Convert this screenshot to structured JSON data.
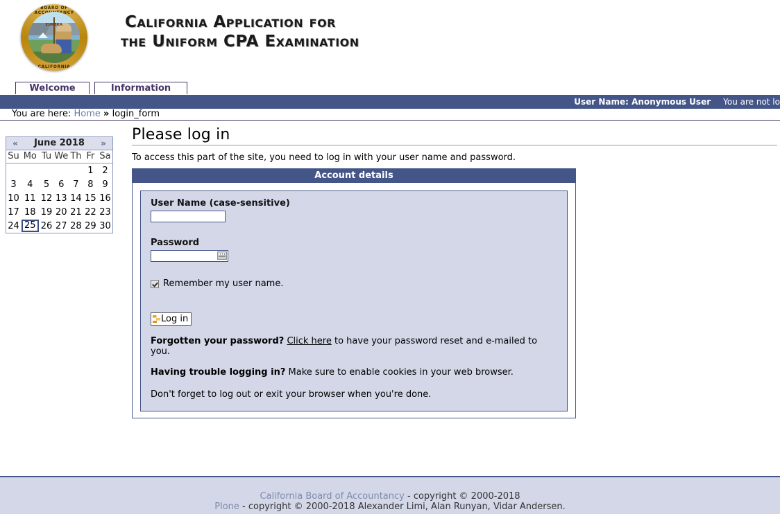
{
  "header": {
    "logo_alt": "California Board of Accountancy Seal",
    "seal": {
      "ring_top": "BOARD OF ACCOUNTANCY",
      "ring_bottom": "CALIFORNIA",
      "motto": "EUREKA"
    },
    "title_line1": "California Application for",
    "title_line2": "the Uniform CPA Examination"
  },
  "globalnav": {
    "tabs": [
      {
        "label": "Welcome",
        "selected": false
      },
      {
        "label": "Information",
        "selected": false
      }
    ]
  },
  "personaltools": {
    "user_name_label": "User Name: Anonymous User",
    "login_status": "You are not lo"
  },
  "breadcrumbs": {
    "prefix": "You are here:",
    "home": "Home",
    "separator": "»",
    "current": "login_form"
  },
  "calendar": {
    "prev_label": "«",
    "next_label": "»",
    "month_year": "June 2018",
    "weekdays": [
      "Su",
      "Mo",
      "Tu",
      "We",
      "Th",
      "Fr",
      "Sa"
    ],
    "weeks": [
      [
        "",
        "",
        "",
        "",
        "",
        "1",
        "2"
      ],
      [
        "3",
        "4",
        "5",
        "6",
        "7",
        "8",
        "9"
      ],
      [
        "10",
        "11",
        "12",
        "13",
        "14",
        "15",
        "16"
      ],
      [
        "17",
        "18",
        "19",
        "20",
        "21",
        "22",
        "23"
      ],
      [
        "24",
        "25",
        "26",
        "27",
        "28",
        "29",
        "30"
      ]
    ],
    "today": "25"
  },
  "content": {
    "title": "Please log in",
    "description": "To access this part of the site, you need to log in with your user name and password."
  },
  "login_form": {
    "panel_title": "Account details",
    "username_label": "User Name (case-sensitive)",
    "username_value": "",
    "username_placeholder": "",
    "password_label": "Password",
    "password_value": "",
    "password_placeholder": "",
    "password_icon": "keyboard-icon",
    "remember_label": "Remember my user name.",
    "remember_checked": true,
    "submit_label": "Log in",
    "submit_icon": "plone-login-icon",
    "forgot_bold": "Forgotten your password?",
    "forgot_link": "Click here",
    "forgot_rest": "to have your password reset and e-mailed to you.",
    "trouble_bold": "Having trouble logging in?",
    "trouble_rest": "Make sure to enable cookies in your web browser.",
    "logout_note": "Don't forget to log out or exit your browser when you're done."
  },
  "footer": {
    "line1_link": "California Board of Accountancy",
    "line1_rest": "- copyright © 2000-2018",
    "line2_link": "Plone",
    "line2_rest": "- copyright © 2000-2018 Alexander Limi, Alan Runyan, Vidar Andersen."
  },
  "colors": {
    "navy": "#445588",
    "panel_bg": "#d3d7e8",
    "link": "#6a7b9e",
    "accent_orange": "#f0a01e"
  }
}
